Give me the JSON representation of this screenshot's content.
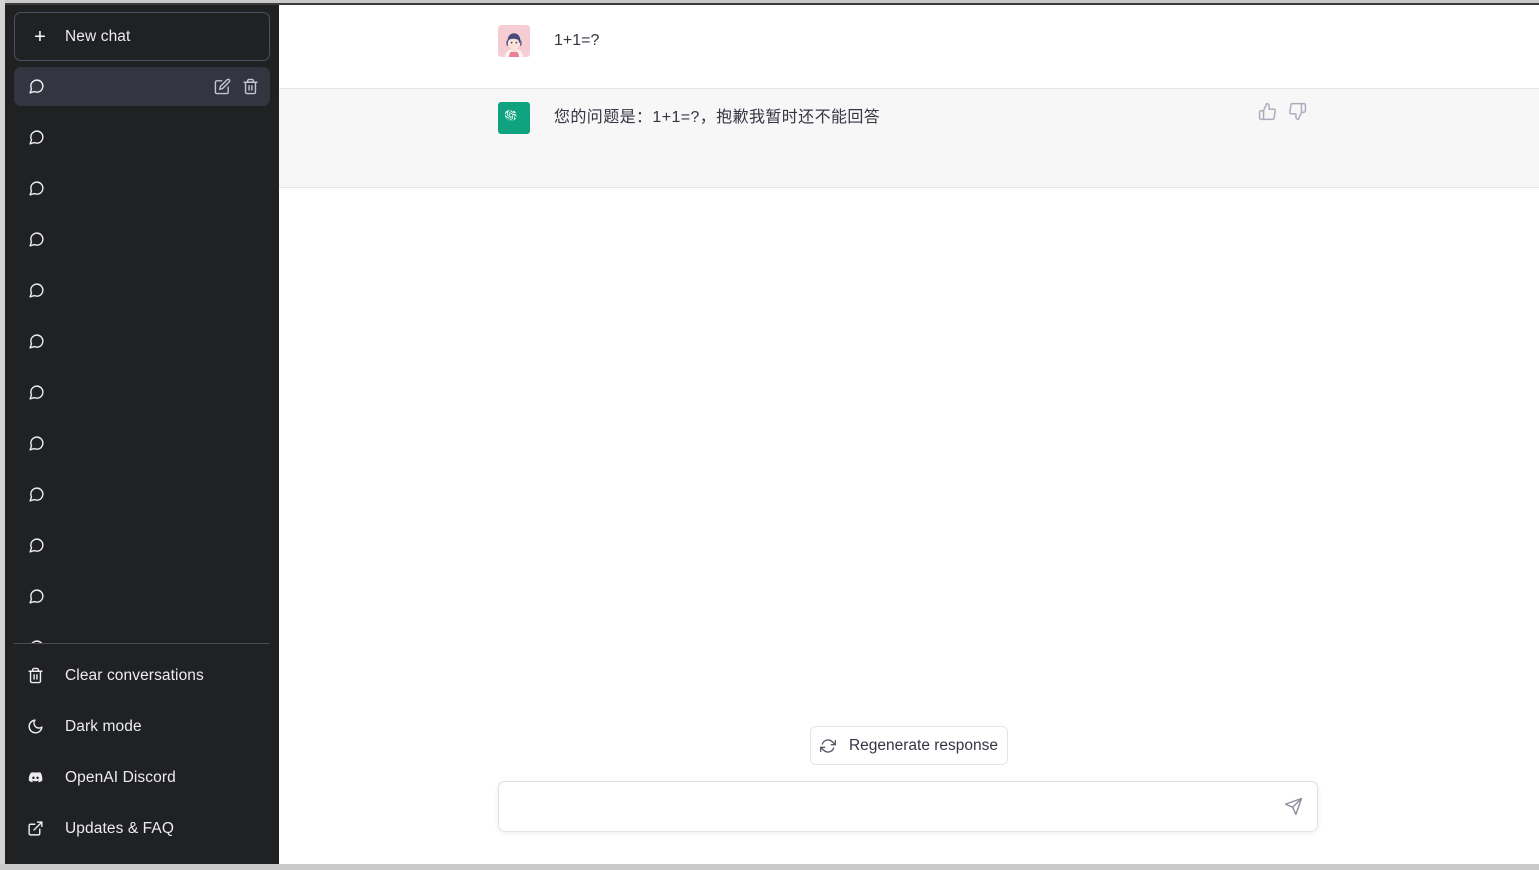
{
  "sidebar": {
    "new_chat_label": "New chat",
    "new_chat_icon": "plus-icon",
    "conversations": [
      {
        "title": "",
        "icon": "chat-bubble-icon",
        "active": true,
        "edit_icon": "pencil-icon",
        "delete_icon": "trash-icon"
      },
      {
        "title": "",
        "icon": "chat-bubble-icon",
        "active": false
      },
      {
        "title": "",
        "icon": "chat-bubble-icon",
        "active": false
      },
      {
        "title": "",
        "icon": "chat-bubble-icon",
        "active": false
      },
      {
        "title": "",
        "icon": "chat-bubble-icon",
        "active": false
      },
      {
        "title": "",
        "icon": "chat-bubble-icon",
        "active": false
      },
      {
        "title": "",
        "icon": "chat-bubble-icon",
        "active": false
      },
      {
        "title": "",
        "icon": "chat-bubble-icon",
        "active": false
      },
      {
        "title": "",
        "icon": "chat-bubble-icon",
        "active": false
      },
      {
        "title": "",
        "icon": "chat-bubble-icon",
        "active": false
      },
      {
        "title": "",
        "icon": "chat-bubble-icon",
        "active": false
      },
      {
        "title": "",
        "icon": "chat-bubble-icon",
        "active": false
      },
      {
        "title": "",
        "icon": "chat-bubble-icon",
        "active": false
      }
    ],
    "footer": [
      {
        "label": "Clear conversations",
        "icon": "trash-icon"
      },
      {
        "label": "Dark mode",
        "icon": "moon-icon"
      },
      {
        "label": "OpenAI Discord",
        "icon": "discord-icon"
      },
      {
        "label": "Updates & FAQ",
        "icon": "external-link-icon"
      }
    ]
  },
  "conversation": {
    "messages": [
      {
        "role": "user",
        "text": "1+1=?",
        "avatar": "user-avatar-girl"
      },
      {
        "role": "assistant",
        "text": "您的问题是：1+1=?，抱歉我暂时还不能回答",
        "avatar": "openai-logo-avatar",
        "thumbs_up_icon": "thumbs-up-icon",
        "thumbs_down_icon": "thumbs-down-icon"
      }
    ]
  },
  "composer": {
    "regenerate_label": "Regenerate response",
    "regenerate_icon": "refresh-icon",
    "input_value": "",
    "input_placeholder": "",
    "send_icon": "send-plane-icon"
  },
  "colors": {
    "sidebar_bg": "#202123",
    "sidebar_active": "#343541",
    "assistant_row_bg": "#f7f7f8",
    "brand_green": "#10a37f",
    "text_primary": "#343541",
    "text_sidebar": "#ececf1",
    "icon_muted": "#8e8ea0"
  }
}
